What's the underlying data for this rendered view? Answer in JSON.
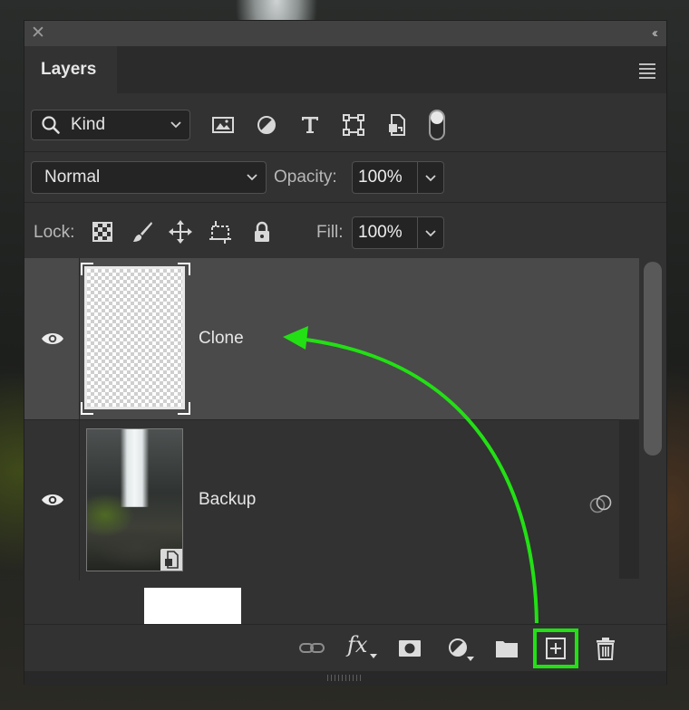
{
  "panel": {
    "tab_label": "Layers",
    "close_icon": "close-icon",
    "collapse_glyph": "‹‹"
  },
  "filter": {
    "kind_label": "Kind",
    "icons": [
      "image-filter-icon",
      "adjustment-filter-icon",
      "type-filter-icon",
      "shape-filter-icon",
      "smart-object-filter-icon"
    ],
    "toggle_on": true
  },
  "blend": {
    "mode": "Normal",
    "opacity_label": "Opacity:",
    "opacity_value": "100%"
  },
  "lock": {
    "label": "Lock:",
    "icons": [
      "lock-transparent-pixels-icon",
      "lock-image-pixels-icon",
      "lock-position-icon",
      "lock-artboard-icon",
      "lock-all-icon"
    ],
    "fill_label": "Fill:",
    "fill_value": "100%"
  },
  "layers": [
    {
      "name": "Clone",
      "visible": true,
      "selected": true
    },
    {
      "name": "Backup",
      "visible": true,
      "selected": false,
      "smart_object": true
    }
  ],
  "bottom_icons": [
    "link-layers-icon",
    "fx-icon",
    "add-mask-icon",
    "adjustment-layer-icon",
    "new-group-icon",
    "new-layer-icon",
    "delete-layer-icon"
  ],
  "fx_text": "fx",
  "colors": {
    "panel_bg": "#323232",
    "selected_layer_bg": "#4a4a4a",
    "annotation_green": "#22e014"
  }
}
